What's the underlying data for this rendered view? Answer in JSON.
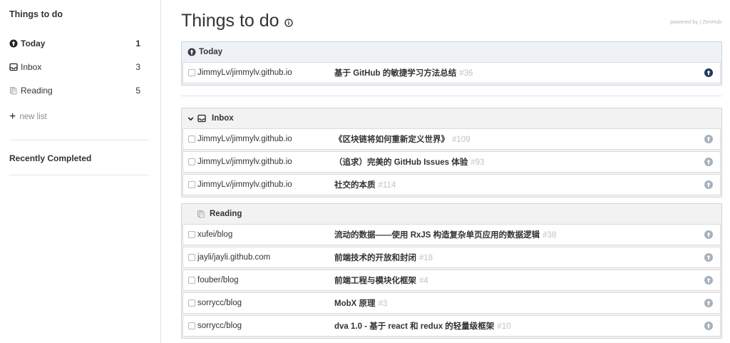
{
  "sidebar": {
    "title": "Things to do",
    "items": [
      {
        "label": "Today",
        "count": "1"
      },
      {
        "label": "Inbox",
        "count": "3"
      },
      {
        "label": "Reading",
        "count": "5"
      }
    ],
    "new_list": "new list",
    "recently_completed": "Recently Completed"
  },
  "main": {
    "title": "Things to do",
    "powered_by": "powered by | ZenHub",
    "today": {
      "title": "Today",
      "rows": [
        {
          "repo": "JimmyLv/jimmylv.github.io",
          "issue": "基于 GitHub 的敏捷学习方法总结",
          "number": "#36"
        }
      ]
    },
    "inbox": {
      "title": "Inbox",
      "rows": [
        {
          "repo": "JimmyLv/jimmylv.github.io",
          "issue": "《区块链将如何重新定义世界》",
          "number": "#109"
        },
        {
          "repo": "JimmyLv/jimmylv.github.io",
          "issue": "（追求）完美的 GitHub Issues 体验",
          "number": "#93"
        },
        {
          "repo": "JimmyLv/jimmylv.github.io",
          "issue": "社交的本质",
          "number": "#114"
        }
      ]
    },
    "reading": {
      "title": "Reading",
      "rows": [
        {
          "repo": "xufei/blog",
          "issue": "流动的数据——使用 RxJS 构造复杂单页应用的数据逻辑",
          "number": "#38"
        },
        {
          "repo": "jayli/jayli.github.com",
          "issue": "前端技术的开放和封闭",
          "number": "#18"
        },
        {
          "repo": "fouber/blog",
          "issue": "前端工程与模块化框架",
          "number": "#4"
        },
        {
          "repo": "sorrycc/blog",
          "issue": "MobX 原理",
          "number": "#3"
        },
        {
          "repo": "sorrycc/blog",
          "issue": "dva 1.0 - 基于 react 和 redux 的轻量级框架",
          "number": "#10"
        }
      ]
    }
  },
  "colors": {
    "accent_dark": "#1f3a5c",
    "action_grey": "#a8b0ba",
    "issue_number": "#c2c2c2"
  }
}
